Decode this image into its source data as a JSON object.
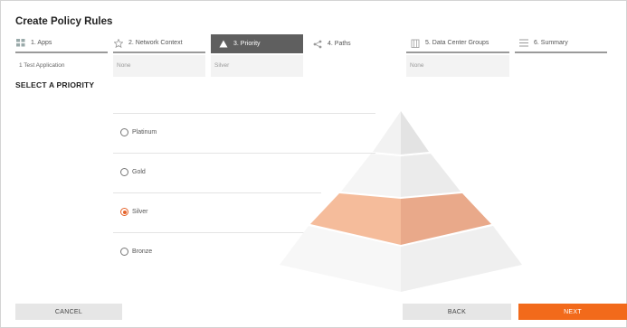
{
  "page": {
    "title": "Create Policy Rules"
  },
  "steps": [
    {
      "label": "1. Apps",
      "icon": "grid-icon",
      "summary": "1 Test Application"
    },
    {
      "label": "2. Network Context",
      "icon": "star-icon",
      "summary": "None"
    },
    {
      "label": "3. Priority",
      "icon": "triangle-icon",
      "summary": "Silver",
      "active": true
    },
    {
      "label": "4. Paths",
      "icon": "share-icon",
      "summary": ""
    },
    {
      "label": "5. Data Center Groups",
      "icon": "building-icon",
      "summary": "None"
    },
    {
      "label": "6. Summary",
      "icon": "list-icon",
      "summary": ""
    }
  ],
  "priority": {
    "heading": "SELECT A PRIORITY",
    "options": [
      "Platinum",
      "Gold",
      "Silver",
      "Bronze"
    ],
    "selected": "Silver"
  },
  "buttons": {
    "cancel": "CANCEL",
    "back": "BACK",
    "next": "NEXT"
  },
  "colors": {
    "accent": "#f26a1b",
    "radio_selected": "#e5632a",
    "active_step": "#5f5f5f",
    "pyramid_highlight": "#f5bc9b"
  }
}
